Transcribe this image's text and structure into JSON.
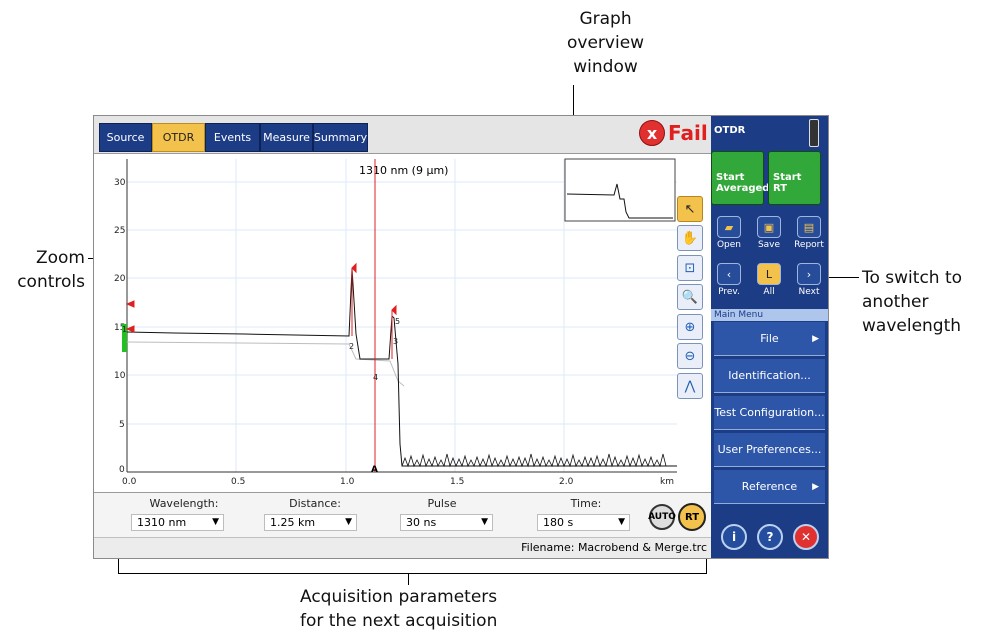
{
  "callouts": {
    "graph_overview": [
      "Graph",
      "overview",
      "window"
    ],
    "zoom": [
      "Zoom",
      "controls"
    ],
    "switch": [
      "To switch to",
      "another",
      "wavelength"
    ],
    "acquisition": [
      "Acquisition parameters",
      "for the next acquisition"
    ]
  },
  "tabs": [
    "Source",
    "OTDR",
    "Events",
    "Measure",
    "Summary"
  ],
  "active_tab": "OTDR",
  "status": {
    "fail_label": "Fail",
    "fail_icon": "x"
  },
  "graph": {
    "trace_title": "1310 nm (9 µm)",
    "y_ticks": [
      "30",
      "25",
      "20",
      "15",
      "10",
      "5",
      "0"
    ],
    "x_ticks": [
      "0.0",
      "0.5",
      "1.0",
      "1.5",
      "2.0",
      "km"
    ],
    "marker_a": "A",
    "event_labels": [
      "1",
      "2",
      "3",
      "4",
      "5"
    ],
    "overview_visible": true
  },
  "params": {
    "wavelength": {
      "label": "Wavelength:",
      "value": "1310 nm"
    },
    "distance": {
      "label": "Distance:",
      "value": "1.25 km"
    },
    "pulse": {
      "label": "Pulse",
      "value": "30 ns"
    },
    "time": {
      "label": "Time:",
      "value": "180 s"
    },
    "auto_label": "AUTO",
    "rt_label": "RT"
  },
  "statusbar": {
    "filename": "Filename: Macrobend & Merge.trc"
  },
  "side": {
    "title": "OTDR",
    "start_averaged": [
      "Start",
      "Averaged"
    ],
    "start_rt": [
      "Start",
      "RT"
    ],
    "file_buttons": [
      "Open",
      "Save",
      "Report"
    ],
    "nav_buttons": [
      "Prev.",
      "All",
      "Next"
    ],
    "main_menu_title": "Main Menu",
    "menu": [
      "File",
      "Identification...",
      "Test Configuration...",
      "User Preferences...",
      "Reference"
    ],
    "bottom_icons": [
      "info-icon",
      "help-icon",
      "close-icon"
    ]
  },
  "colors": {
    "tab_blue": "#1d3c86",
    "tab_active": "#f3c24c",
    "fail_red": "#e02020",
    "start_green": "#33a83a",
    "marker_red": "#e02020"
  }
}
